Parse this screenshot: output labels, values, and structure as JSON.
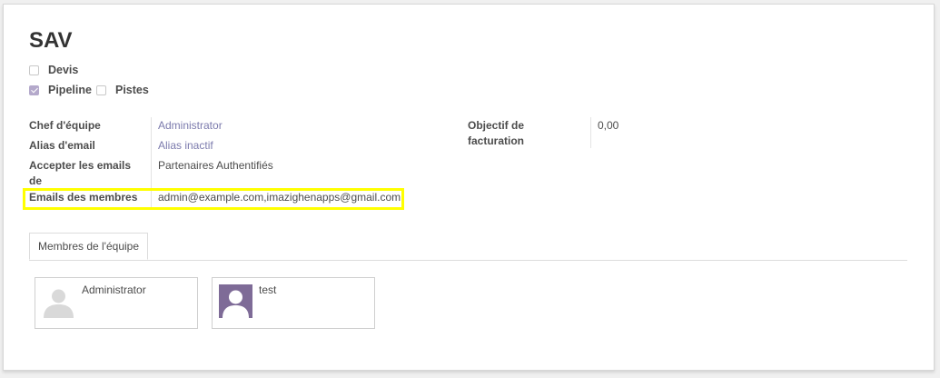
{
  "record": {
    "title": "SAV"
  },
  "checkboxes": {
    "devis": {
      "label": "Devis",
      "checked": false
    },
    "pipeline": {
      "label": "Pipeline",
      "checked": true
    },
    "pistes": {
      "label": "Pistes",
      "checked": false
    }
  },
  "fields": {
    "team_leader": {
      "label": "Chef d'équipe",
      "value": "Administrator"
    },
    "email_alias": {
      "label": "Alias d'email",
      "value": "Alias inactif"
    },
    "accept_emails": {
      "label_line1": "Accepter les emails",
      "label_line2": "de",
      "value": "Partenaires Authentifiés"
    },
    "member_emails": {
      "label": "Emails des membres",
      "value": "admin@example.com,imazighenapps@gmail.com"
    },
    "invoicing_target": {
      "label_line1": "Objectif de",
      "label_line2": "facturation",
      "value": "0,00"
    }
  },
  "tabs": {
    "members_tab": "Membres de l'équipe"
  },
  "members": [
    {
      "name": "Administrator",
      "avatar": "default-avatar-icon"
    },
    {
      "name": "test",
      "avatar": "purple-avatar-icon"
    }
  ],
  "colors": {
    "link": "#7c7bad",
    "highlight": "#ffff00",
    "checkbox_checked": "#b4a9cb",
    "avatar_purple": "#7e6b97"
  }
}
